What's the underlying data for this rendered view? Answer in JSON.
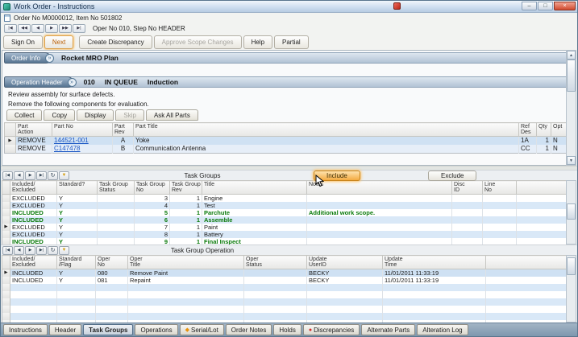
{
  "window": {
    "title": "Work Order - Instructions",
    "order_line": "Order No  M0000012, Item No  501802",
    "oper_line": "Oper No 010, Step No HEADER"
  },
  "icons": {
    "minimize": "–",
    "maximize": "□",
    "close": "×",
    "nav_first": "|◀",
    "nav_prev_page": "◀◀",
    "nav_prev": "◀",
    "nav_next": "▶",
    "nav_next_page": "▶▶",
    "nav_last": "▶|",
    "grid_first": "|◀",
    "grid_prev": "◀",
    "grid_next": "▶",
    "grid_last": "▶|",
    "refresh": "↻",
    "filter": "▼",
    "row_marker": "▶",
    "scroll_up": "▲",
    "scroll_down": "▼",
    "section_toggle": "»"
  },
  "toolbar": {
    "buttons": [
      {
        "label": "Sign On",
        "state": "normal"
      },
      {
        "label": "Next",
        "state": "focused"
      },
      {
        "label": "Create Discrepancy",
        "state": "normal"
      },
      {
        "label": "Approve Scope Changes",
        "state": "disabled"
      },
      {
        "label": "Help",
        "state": "normal"
      },
      {
        "label": "Partial",
        "state": "normal"
      }
    ]
  },
  "order_info": {
    "label": "Order Info",
    "value": "Rocket MRO Plan"
  },
  "operation_header": {
    "label": "Operation Header",
    "oper_no": "010",
    "status": "IN QUEUE",
    "title": "Induction"
  },
  "instructions": {
    "line1": "Review assembly for surface defects.",
    "line2": "Remove the following components for evaluation."
  },
  "parts": {
    "buttons": [
      {
        "label": "Collect",
        "state": "normal"
      },
      {
        "label": "Copy",
        "state": "normal"
      },
      {
        "label": "Display",
        "state": "normal"
      },
      {
        "label": "Skip",
        "state": "disabled"
      },
      {
        "label": "Ask All Parts",
        "state": "normal"
      }
    ],
    "columns": {
      "action_1": "Part",
      "action_2": "Action",
      "part_no": "Part No",
      "rev_1": "Part",
      "rev_2": "Rev",
      "title": "Part Title",
      "ref_1": "Ref",
      "ref_2": "Des",
      "qty": "Qty",
      "opt": "Opt"
    },
    "rows": [
      {
        "action": "REMOVE",
        "part_no": "144521-001",
        "rev": "A",
        "title": "Yoke",
        "ref_des": "1A",
        "qty": "1",
        "opt": "N"
      },
      {
        "action": "REMOVE",
        "part_no": "C147478",
        "rev": "B",
        "title": "Communication Antenna",
        "ref_des": "CC",
        "qty": "1",
        "opt": "N"
      }
    ]
  },
  "task_groups": {
    "section_title": "Task Groups",
    "include_button": "Include",
    "exclude_button": "Exclude",
    "columns": {
      "included_1": "Included/",
      "included_2": "Excluded",
      "standard": "Standard?",
      "status_1": "Task Group",
      "status_2": "Status",
      "no_1": "Task Group",
      "no_2": "No",
      "rev_1": "Task Group",
      "rev_2": "Rev",
      "title": "Title",
      "notes": "Notes",
      "disc_1": "Disc",
      "disc_2": "ID",
      "line_1": "Line",
      "line_2": "No"
    },
    "rows": [
      {
        "included": "EXCLUDED",
        "standard": "Y",
        "status": "",
        "no": "3",
        "rev": "1",
        "title": "Engine",
        "notes": ""
      },
      {
        "included": "EXCLUDED",
        "standard": "Y",
        "status": "",
        "no": "4",
        "rev": "1",
        "title": "Test",
        "notes": ""
      },
      {
        "included": "INCLUDED",
        "standard": "Y",
        "status": "",
        "no": "5",
        "rev": "1",
        "title": "Parchute",
        "notes": "Additional work scope."
      },
      {
        "included": "INCLUDED",
        "standard": "Y",
        "status": "",
        "no": "6",
        "rev": "1",
        "title": "Assemble",
        "notes": ""
      },
      {
        "included": "EXCLUDED",
        "standard": "Y",
        "status": "",
        "no": "7",
        "rev": "1",
        "title": "Paint",
        "notes": ""
      },
      {
        "included": "EXCLUDED",
        "standard": "Y",
        "status": "",
        "no": "8",
        "rev": "1",
        "title": "Battery",
        "notes": ""
      },
      {
        "included": "INCLUDED",
        "standard": "Y",
        "status": "",
        "no": "9",
        "rev": "1",
        "title": "Final Inspect",
        "notes": ""
      }
    ]
  },
  "task_group_operations": {
    "section_title": "Task Group Operation",
    "columns": {
      "included_1": "Included/",
      "included_2": "Excluded",
      "standard_1": "Standard",
      "standard_2": "/Flag",
      "oper_no_1": "Oper",
      "oper_no_2": "No",
      "oper_title_1": "Oper",
      "oper_title_2": "Title",
      "oper_status_1": "Oper",
      "oper_status_2": "Status",
      "user_1": "Update",
      "user_2": "UserID",
      "time_1": "Update",
      "time_2": "Time"
    },
    "rows": [
      {
        "included": "INCLUDED",
        "standard": "Y",
        "oper_no": "080",
        "oper_title": "Remove Paint",
        "oper_status": "",
        "user": "BECKY",
        "time": "11/01/2011 11:33:19"
      },
      {
        "included": "INCLUDED",
        "standard": "Y",
        "oper_no": "081",
        "oper_title": "Repaint",
        "oper_status": "",
        "user": "BECKY",
        "time": "11/01/2011 11:33:19"
      }
    ]
  },
  "bottom_tabs": {
    "tabs": [
      {
        "label": "Instructions"
      },
      {
        "label": "Header"
      },
      {
        "label": "Task Groups",
        "active": true
      },
      {
        "label": "Operations"
      },
      {
        "label": "Serial/Lot",
        "icon": "◆"
      },
      {
        "label": "Order Notes"
      },
      {
        "label": "Holds"
      },
      {
        "label": "Discrepancies",
        "icon": "●"
      },
      {
        "label": "Alternate Parts"
      },
      {
        "label": "Alteration Log"
      }
    ]
  },
  "colors": {
    "included_green": "#0a7a0a",
    "link_blue": "#1a56c4",
    "include_highlight": "#f5a623",
    "row_alt_blue": "#d9e8f7",
    "serial_lot_icon": "#e8920c",
    "discrepancy_icon": "#d42a2a"
  }
}
